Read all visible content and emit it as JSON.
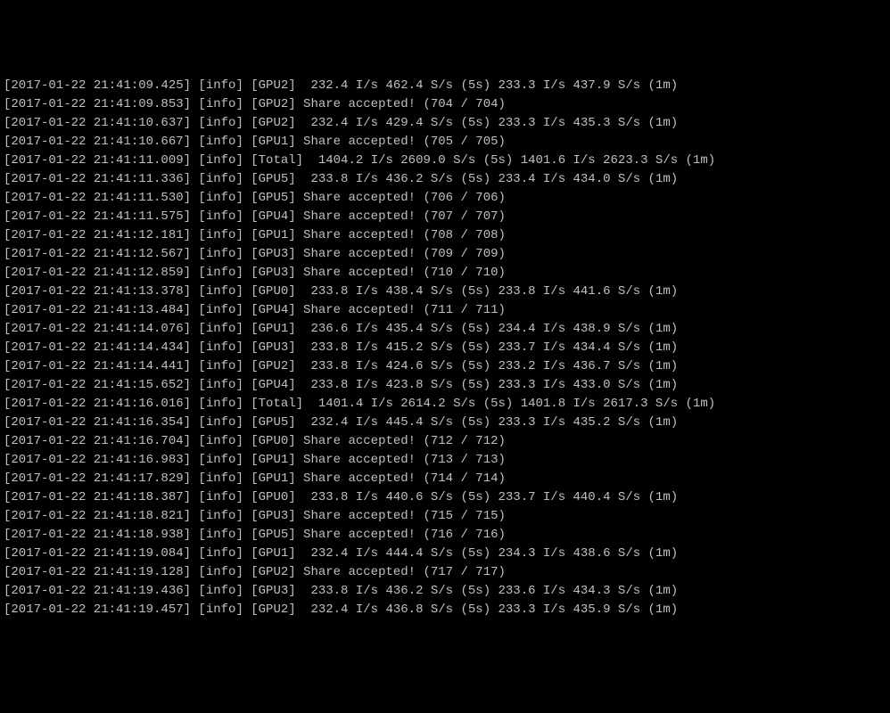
{
  "lines": [
    "[2017-01-22 21:41:09.425] [info] [GPU2]  232.4 I/s 462.4 S/s (5s) 233.3 I/s 437.9 S/s (1m)",
    "[2017-01-22 21:41:09.853] [info] [GPU2] Share accepted! (704 / 704)",
    "[2017-01-22 21:41:10.637] [info] [GPU2]  232.4 I/s 429.4 S/s (5s) 233.3 I/s 435.3 S/s (1m)",
    "[2017-01-22 21:41:10.667] [info] [GPU1] Share accepted! (705 / 705)",
    "[2017-01-22 21:41:11.009] [info] [Total]  1404.2 I/s 2609.0 S/s (5s) 1401.6 I/s 2623.3 S/s (1m)",
    "[2017-01-22 21:41:11.336] [info] [GPU5]  233.8 I/s 436.2 S/s (5s) 233.4 I/s 434.0 S/s (1m)",
    "[2017-01-22 21:41:11.530] [info] [GPU5] Share accepted! (706 / 706)",
    "[2017-01-22 21:41:11.575] [info] [GPU4] Share accepted! (707 / 707)",
    "[2017-01-22 21:41:12.181] [info] [GPU1] Share accepted! (708 / 708)",
    "[2017-01-22 21:41:12.567] [info] [GPU3] Share accepted! (709 / 709)",
    "[2017-01-22 21:41:12.859] [info] [GPU3] Share accepted! (710 / 710)",
    "[2017-01-22 21:41:13.378] [info] [GPU0]  233.8 I/s 438.4 S/s (5s) 233.8 I/s 441.6 S/s (1m)",
    "[2017-01-22 21:41:13.484] [info] [GPU4] Share accepted! (711 / 711)",
    "[2017-01-22 21:41:14.076] [info] [GPU1]  236.6 I/s 435.4 S/s (5s) 234.4 I/s 438.9 S/s (1m)",
    "[2017-01-22 21:41:14.434] [info] [GPU3]  233.8 I/s 415.2 S/s (5s) 233.7 I/s 434.4 S/s (1m)",
    "[2017-01-22 21:41:14.441] [info] [GPU2]  233.8 I/s 424.6 S/s (5s) 233.2 I/s 436.7 S/s (1m)",
    "[2017-01-22 21:41:15.652] [info] [GPU4]  233.8 I/s 423.8 S/s (5s) 233.3 I/s 433.0 S/s (1m)",
    "[2017-01-22 21:41:16.016] [info] [Total]  1401.4 I/s 2614.2 S/s (5s) 1401.8 I/s 2617.3 S/s (1m)",
    "[2017-01-22 21:41:16.354] [info] [GPU5]  232.4 I/s 445.4 S/s (5s) 233.3 I/s 435.2 S/s (1m)",
    "[2017-01-22 21:41:16.704] [info] [GPU0] Share accepted! (712 / 712)",
    "[2017-01-22 21:41:16.983] [info] [GPU1] Share accepted! (713 / 713)",
    "[2017-01-22 21:41:17.829] [info] [GPU1] Share accepted! (714 / 714)",
    "[2017-01-22 21:41:18.387] [info] [GPU0]  233.8 I/s 440.6 S/s (5s) 233.7 I/s 440.4 S/s (1m)",
    "[2017-01-22 21:41:18.821] [info] [GPU3] Share accepted! (715 / 715)",
    "[2017-01-22 21:41:18.938] [info] [GPU5] Share accepted! (716 / 716)",
    "[2017-01-22 21:41:19.084] [info] [GPU1]  232.4 I/s 444.4 S/s (5s) 234.3 I/s 438.6 S/s (1m)",
    "[2017-01-22 21:41:19.128] [info] [GPU2] Share accepted! (717 / 717)",
    "[2017-01-22 21:41:19.436] [info] [GPU3]  233.8 I/s 436.2 S/s (5s) 233.6 I/s 434.3 S/s (1m)",
    "[2017-01-22 21:41:19.457] [info] [GPU2]  232.4 I/s 436.8 S/s (5s) 233.3 I/s 435.9 S/s (1m)"
  ]
}
